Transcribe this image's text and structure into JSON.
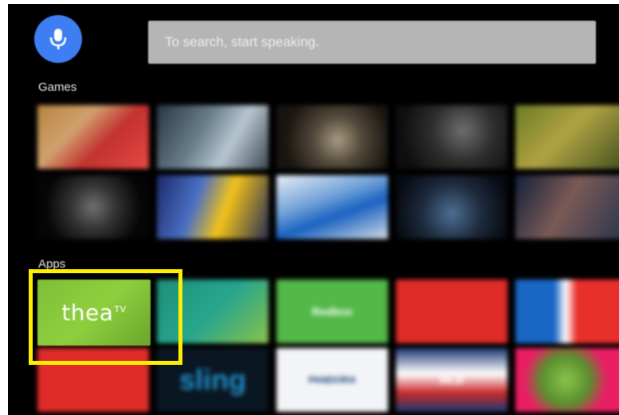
{
  "search": {
    "placeholder": "To search, start speaking.",
    "icon": "mic-icon"
  },
  "sections": {
    "games_label": "Games",
    "apps_label": "Apps"
  },
  "apps": {
    "thea": {
      "logo_text": "thea",
      "logo_sup": "TV"
    },
    "row1_texts": [
      "",
      "",
      "Redbox",
      "",
      ""
    ],
    "row2_texts": [
      "",
      "sling",
      "PANDORA",
      "MLB",
      ""
    ]
  },
  "colors": {
    "accent": "#3d7ff2",
    "highlight": "#ffee00",
    "background": "#000000"
  }
}
